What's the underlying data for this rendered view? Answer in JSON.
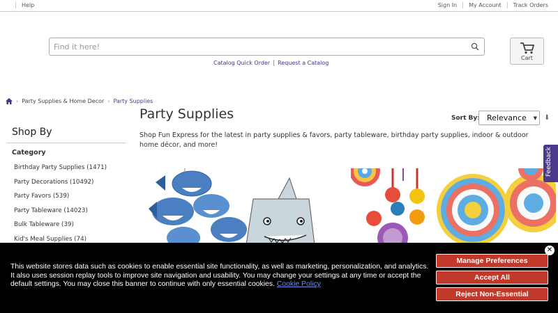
{
  "topbar": {
    "help": "Help",
    "sign_in": "Sign In",
    "my_account": "My Account",
    "track_orders": "Track Orders"
  },
  "search": {
    "placeholder": "Find it here!",
    "icon": "search-icon"
  },
  "cart": {
    "label": "Cart",
    "icon": "cart-icon"
  },
  "sublinks": {
    "catalog_quick_order": "Catalog Quick Order",
    "request_catalog": "Request a Catalog"
  },
  "breadcrumb": {
    "home_icon": "home-icon",
    "items": [
      "Party Supplies & Home Decor",
      "Party Supplies"
    ]
  },
  "page": {
    "title": "Party Supplies",
    "description": "Shop Fun Express for the latest in party supplies & favors, party tableware, birthday party supplies, indoor & outdoor home décor, and more!"
  },
  "sort": {
    "label": "Sort By:",
    "selected": "Relevance"
  },
  "sidebar": {
    "title": "Shop By",
    "category_heading": "Category",
    "categories": [
      "Birthday Party Supplies (1471)",
      "Party Decorations (10492)",
      "Party Favors (539)",
      "Party Tableware (14023)",
      "Bulk Tableware (39)",
      "Kid's Meal Supplies (74)"
    ]
  },
  "feedback": {
    "label": "Feedback"
  },
  "cookie_banner": {
    "text": "This website stores data such as cookies to enable essential site functionality, as well as marketing, personalization, and analytics. It also uses session replay tools to improve site navigation and usability. You may change your settings at any time or accept the default settings. You may close this banner to continue with only essential cookies.",
    "policy_link": "Cookie Policy",
    "manage_button": "Manage Preferences",
    "accept_button": "Accept All",
    "reject_button": "Reject Non-Essential",
    "close_icon": "close-icon"
  },
  "colors": {
    "accent_purple": "#4b3a8c",
    "link_blue": "#3c3a8a",
    "button_red": "#c0392b",
    "banner_bg": "#000000"
  }
}
